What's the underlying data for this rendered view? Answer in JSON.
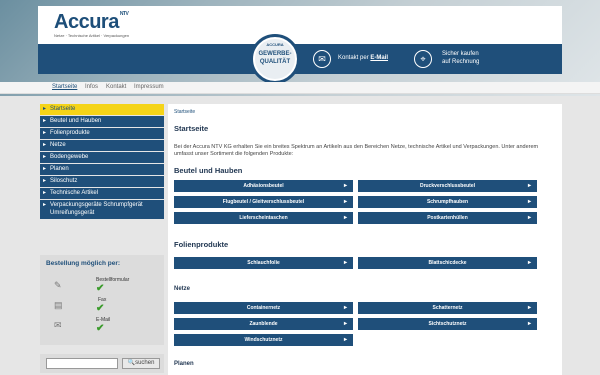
{
  "brand": {
    "logo": "Accura",
    "logo_tag": "NTV",
    "logo_subtitle": "Netze · Technische Artikel · Verpackungen"
  },
  "seal": {
    "top": "ACCURA",
    "line1": "GEWERBE-",
    "line2": "QUALITÄT"
  },
  "header_info": {
    "contact_text": "Kontakt per",
    "contact_link": "E-Mail",
    "payment_line1": "Sicher kaufen",
    "payment_line2": "auf Rechnung"
  },
  "topnav": [
    "Startseite",
    "Infos",
    "Kontakt",
    "Impressum"
  ],
  "sidebar": [
    "Startseite",
    "Beutel und Hauben",
    "Folienprodukte",
    "Netze",
    "Bodengewebe",
    "Planen",
    "Siloschutz",
    "Technische Artikel",
    "Verpackungsgeräte Schrumpfgerät Umreifungsgerät"
  ],
  "order": {
    "title": "Bestellung möglich per:",
    "methods": [
      "Bestellformular",
      "Fax",
      "E-Mail"
    ]
  },
  "search": {
    "placeholder": "",
    "button": "suchen"
  },
  "main": {
    "breadcrumb": "Startseite",
    "title": "Startseite",
    "intro": "Bei der Accura NTV KG erhalten Sie ein breites Spektrum an Artikeln aus den Bereichen Netze, technische Artikel und Verpackungen. Unter anderem umfasst unser Sortiment die folgenden Produkte:",
    "sections": [
      {
        "title": "Beutel und Hauben",
        "items": [
          "Adhäsionsbeutel",
          "Druckverschlussbeutel",
          "Flugbeutel / Gleitverschlussbeutel",
          "Schrumpfhauben",
          "Lieferscheintaschen",
          "Postkartenhüllen"
        ]
      },
      {
        "title": "Folienprodukte",
        "items": [
          "Schlauchfolie",
          "Blattschicdecke"
        ]
      },
      {
        "title": "Netze",
        "items": [
          "Containernetz",
          "Schatternetz",
          "Zaunblende",
          "Sichtschutznetz",
          "Windschutznetz"
        ]
      },
      {
        "title": "Planen",
        "items": []
      }
    ]
  }
}
